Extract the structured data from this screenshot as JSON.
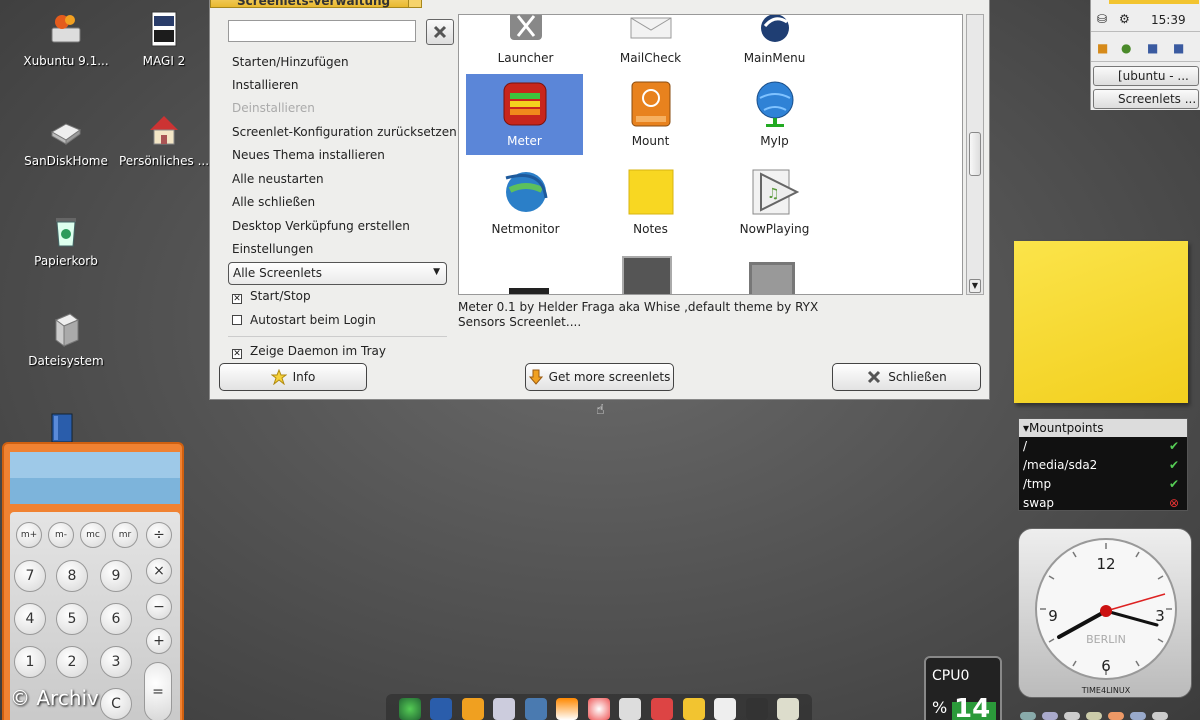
{
  "desktop": {
    "icons": [
      {
        "label": "Xubuntu 9.1..."
      },
      {
        "label": "MAGI 2"
      },
      {
        "label": "SanDiskHome"
      },
      {
        "label": "Persönliches ..."
      },
      {
        "label": "Papierkorb"
      },
      {
        "label": "Dateisystem"
      }
    ],
    "watermark": "© Archiv"
  },
  "window": {
    "title": "Screenlets-Verwaltung",
    "search_value": "",
    "menu": [
      {
        "label": "Starten/Hinzufügen",
        "enabled": true
      },
      {
        "label": "Installieren",
        "enabled": true
      },
      {
        "label": "Deinstallieren",
        "enabled": false
      },
      {
        "label": "Screenlet-Konfiguration zurücksetzen",
        "enabled": true
      },
      {
        "label": "Neues Thema installieren",
        "enabled": true
      },
      {
        "label": "Alle neustarten",
        "enabled": true
      },
      {
        "label": "Alle schließen",
        "enabled": true
      },
      {
        "label": "Desktop Verküpfung erstellen",
        "enabled": true
      },
      {
        "label": "Einstellungen",
        "enabled": true
      }
    ],
    "filter_selected": "Alle Screenlets",
    "checks": [
      {
        "label": "Start/Stop",
        "checked": true
      },
      {
        "label": "Autostart beim Login",
        "checked": false
      },
      {
        "label": "Zeige Daemon im Tray",
        "checked": true
      }
    ],
    "screenlets": [
      {
        "label": "Launcher",
        "icon": "launcher-icon"
      },
      {
        "label": "MailCheck",
        "icon": "mail-icon"
      },
      {
        "label": "MainMenu",
        "icon": "mainmenu-icon"
      },
      {
        "label": "Meter",
        "icon": "meter-icon",
        "selected": true
      },
      {
        "label": "Mount",
        "icon": "mount-icon"
      },
      {
        "label": "MyIp",
        "icon": "globe-icon"
      },
      {
        "label": "Netmonitor",
        "icon": "netmonitor-icon"
      },
      {
        "label": "Notes",
        "icon": "notes-icon"
      },
      {
        "label": "NowPlaying",
        "icon": "nowplaying-icon"
      }
    ],
    "description": "Meter 0.1 by Helder Fraga aka Whise ,default theme by RYX Sensors Screenlet....",
    "buttons": {
      "info": "Info",
      "more": "Get more screenlets",
      "close": "Schließen"
    }
  },
  "tray": {
    "time": "15:39",
    "tasks": [
      "[ubuntu - ...",
      "Screenlets ..."
    ]
  },
  "mounts": {
    "title": "Mountpoints",
    "rows": [
      {
        "path": "/",
        "ok": true
      },
      {
        "path": "/media/sda2",
        "ok": true
      },
      {
        "path": "/tmp",
        "ok": true
      },
      {
        "path": "swap",
        "ok": false
      }
    ]
  },
  "clock": {
    "numerals": [
      "12",
      "3",
      "6",
      "9"
    ],
    "city": "BERLIN",
    "brand": "TIME4LINUX"
  },
  "calculator": {
    "memory_keys": [
      "m+",
      "m-",
      "mc",
      "mr"
    ],
    "keys": [
      "÷",
      "7",
      "8",
      "9",
      "×",
      "4",
      "5",
      "6",
      "−",
      "+",
      "1",
      "2",
      "3",
      "=",
      "C"
    ]
  },
  "cpu": {
    "label": "CPU0",
    "unit": "%",
    "value": "14"
  },
  "colors": {
    "selection": "#5b86d8",
    "calc_orange": "#f08232",
    "note_yellow": "#f6d72f"
  }
}
